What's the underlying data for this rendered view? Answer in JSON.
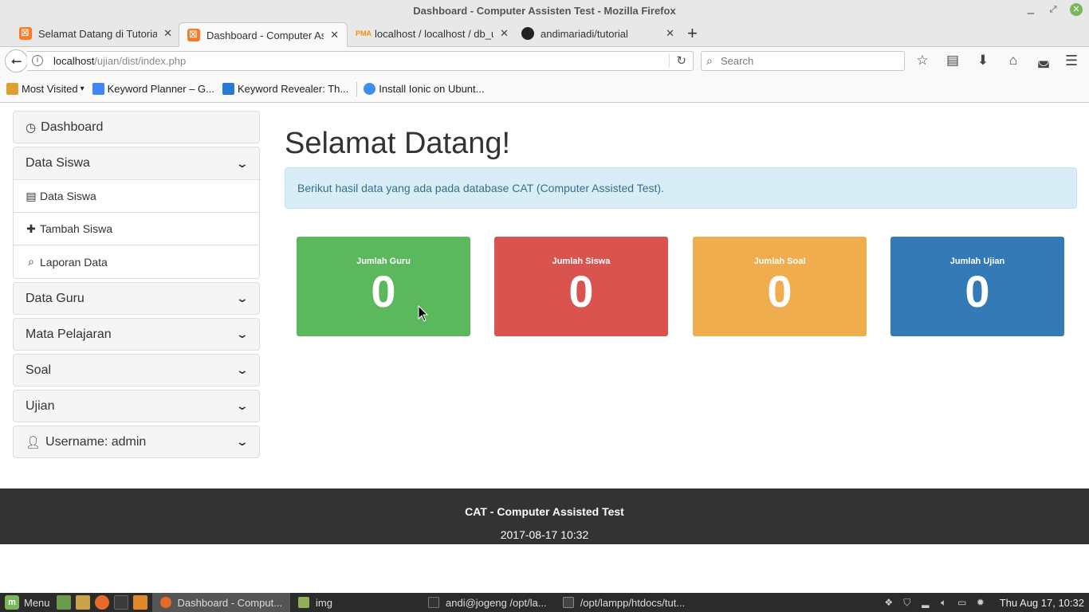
{
  "window": {
    "title": "Dashboard - Computer Assisten Test - Mozilla Firefox"
  },
  "tabs": [
    {
      "label": "Selamat Datang di Tutorial"
    },
    {
      "label": "Dashboard - Computer Assi"
    },
    {
      "label": "localhost / localhost / db_uji"
    },
    {
      "label": "andimariadi/tutorial"
    }
  ],
  "navbar": {
    "url_host": "localhost",
    "url_path": "/ujian/dist/index.php",
    "search_placeholder": "Search"
  },
  "bookmarks": [
    {
      "label": "Most Visited"
    },
    {
      "label": "Keyword Planner – G..."
    },
    {
      "label": "Keyword Revealer: Th..."
    },
    {
      "label": "Install Ionic on Ubunt..."
    }
  ],
  "sidebar": {
    "dashboard": "Dashboard",
    "data_siswa": "Data Siswa",
    "siswa_items": [
      "Data Siswa",
      "Tambah Siswa",
      "Laporan Data"
    ],
    "data_guru": "Data Guru",
    "mata_pelajaran": "Mata Pelajaran",
    "soal": "Soal",
    "ujian": "Ujian",
    "username": "Username: admin"
  },
  "main": {
    "title": "Selamat Datang!",
    "alert": "Berikut hasil data yang ada pada database CAT (Computer Assisted Test).",
    "stats": [
      {
        "label": "Jumlah Guru",
        "value": "0",
        "color": "#5cb85c"
      },
      {
        "label": "Jumlah Siswa",
        "value": "0",
        "color": "#d9534f"
      },
      {
        "label": "Jumlah Soal",
        "value": "0",
        "color": "#f0ad4e"
      },
      {
        "label": "Jumlah Ujian",
        "value": "0",
        "color": "#337ab7"
      }
    ]
  },
  "footer": {
    "title": "CAT - Computer Assisted Test",
    "date": "2017-08-17 10:32"
  },
  "taskbar": {
    "menu": "Menu",
    "windows": [
      {
        "label": "Dashboard - Comput..."
      },
      {
        "label": "img"
      },
      {
        "label": "andi@jogeng /opt/la..."
      },
      {
        "label": "/opt/lampp/htdocs/tut..."
      }
    ],
    "clock": "Thu Aug 17, 10:32"
  },
  "icons": {
    "dashboard": "tachometer-icon",
    "list": "list-icon",
    "plus": "plus-icon",
    "search": "search-icon",
    "user": "user-icon",
    "chevron": "chevron-down-icon"
  }
}
